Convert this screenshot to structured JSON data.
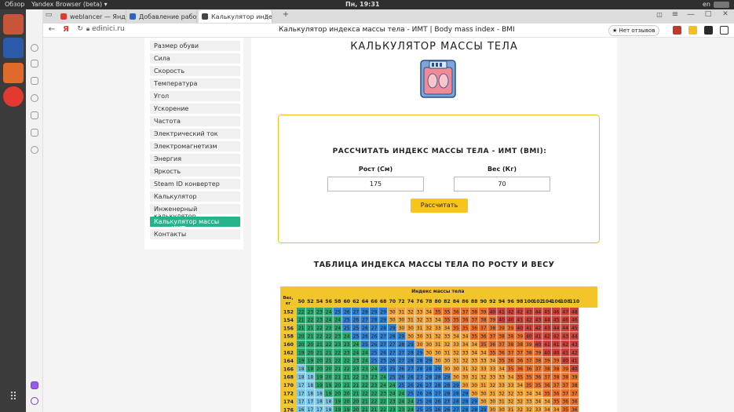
{
  "os": {
    "activities": "Обзор",
    "browser_name": "Yandex Browser (beta)",
    "clock": "Пн, 19:31",
    "lang": "en"
  },
  "tabs": [
    {
      "label": "weblancer — Яндекс:наш",
      "favcolor": "#e03a2e"
    },
    {
      "label": "Добавление работы в по",
      "favcolor": "#2a64c8"
    },
    {
      "label": "Калькулятор индекса м",
      "favcolor": "#444444"
    }
  ],
  "nav": {
    "url": "edinici.ru",
    "page_title": "Калькулятор индекса массы тела - ИМТ | Body mass index - BMI",
    "reviews": "★ Нет отзывов"
  },
  "menu": [
    "Размер обуви",
    "Сила",
    "Скорость",
    "Температура",
    "Угол",
    "Ускорение",
    "Частота",
    "Электрический ток",
    "Электромагнетизм",
    "Энергия",
    "Яркость",
    "Steam ID конвертер",
    "Калькулятор",
    "Инженерный калькулятор",
    "Калькулятор массы тела ИМТ",
    "Контакты"
  ],
  "menu_active": 14,
  "main": {
    "heading": "КАЛЬКУЛЯТОР МАССЫ ТЕЛА",
    "calc_title": "РАССЧИТАТЬ ИНДЕКС МАССЫ ТЕЛА - ИМТ (BMI):",
    "height_label": "Рост (См)",
    "weight_label": "Вес (Кг)",
    "height_value": "175",
    "weight_value": "70",
    "button": "Рассчитать",
    "table_title": "ТАБЛИЦА ИНДЕКСА МАССЫ ТЕЛА ПО РОСТУ И ВЕСУ"
  },
  "bmi_table": {
    "group_header": "Индекс массы тела",
    "corner": "Вес, кг",
    "weights": [
      50,
      52,
      54,
      56,
      58,
      60,
      62,
      64,
      66,
      68,
      70,
      72,
      74,
      76,
      78,
      80,
      82,
      84,
      86,
      88,
      90,
      92,
      94,
      96,
      98,
      100,
      102,
      104,
      106,
      108,
      110
    ],
    "heights": [
      152,
      154,
      156,
      158,
      160,
      162,
      164,
      166,
      168,
      170,
      172,
      174,
      176
    ],
    "rows": [
      [
        22,
        23,
        23,
        24,
        25,
        26,
        27,
        28,
        29,
        29,
        30,
        31,
        32,
        33,
        34,
        35,
        35,
        36,
        37,
        38,
        39,
        40,
        41,
        42,
        42,
        43,
        44,
        45,
        46,
        47,
        48
      ],
      [
        21,
        22,
        23,
        24,
        24,
        25,
        26,
        27,
        28,
        29,
        30,
        30,
        31,
        32,
        33,
        34,
        35,
        35,
        36,
        37,
        38,
        39,
        40,
        40,
        41,
        42,
        43,
        44,
        45,
        46,
        46
      ],
      [
        21,
        21,
        22,
        23,
        24,
        25,
        25,
        26,
        27,
        28,
        29,
        30,
        30,
        31,
        32,
        33,
        34,
        35,
        35,
        36,
        37,
        38,
        39,
        39,
        40,
        41,
        42,
        43,
        44,
        44,
        45
      ],
      [
        20,
        21,
        22,
        22,
        23,
        24,
        25,
        26,
        26,
        27,
        28,
        29,
        30,
        30,
        31,
        32,
        33,
        34,
        34,
        35,
        36,
        37,
        38,
        38,
        39,
        40,
        41,
        42,
        42,
        43,
        44
      ],
      [
        20,
        20,
        21,
        22,
        23,
        23,
        24,
        25,
        26,
        27,
        27,
        28,
        29,
        30,
        30,
        31,
        32,
        33,
        34,
        34,
        35,
        36,
        37,
        38,
        38,
        39,
        40,
        41,
        41,
        42,
        43
      ],
      [
        19,
        20,
        21,
        21,
        22,
        23,
        24,
        24,
        25,
        26,
        27,
        27,
        28,
        29,
        30,
        30,
        31,
        32,
        33,
        34,
        34,
        35,
        36,
        37,
        37,
        38,
        39,
        40,
        40,
        41,
        42
      ],
      [
        19,
        19,
        20,
        21,
        22,
        22,
        23,
        24,
        25,
        25,
        26,
        27,
        28,
        28,
        29,
        30,
        30,
        31,
        32,
        33,
        33,
        34,
        35,
        36,
        36,
        37,
        38,
        39,
        39,
        40,
        41
      ],
      [
        18,
        19,
        20,
        20,
        21,
        22,
        23,
        23,
        24,
        25,
        25,
        26,
        27,
        28,
        28,
        29,
        30,
        30,
        31,
        32,
        33,
        33,
        34,
        35,
        36,
        36,
        37,
        38,
        38,
        39,
        40
      ],
      [
        18,
        18,
        19,
        20,
        21,
        21,
        22,
        23,
        23,
        24,
        25,
        26,
        26,
        27,
        28,
        28,
        29,
        30,
        30,
        31,
        32,
        33,
        33,
        34,
        35,
        35,
        36,
        37,
        38,
        38,
        39
      ],
      [
        17,
        18,
        19,
        19,
        20,
        21,
        21,
        22,
        23,
        24,
        24,
        25,
        26,
        26,
        27,
        28,
        28,
        29,
        30,
        30,
        31,
        32,
        33,
        33,
        34,
        35,
        35,
        36,
        37,
        37,
        38
      ],
      [
        17,
        18,
        18,
        19,
        20,
        20,
        21,
        22,
        22,
        23,
        24,
        24,
        25,
        26,
        26,
        27,
        28,
        28,
        29,
        30,
        30,
        31,
        32,
        32,
        33,
        34,
        34,
        35,
        36,
        37,
        37
      ],
      [
        17,
        17,
        18,
        18,
        19,
        20,
        20,
        21,
        22,
        22,
        23,
        24,
        24,
        25,
        26,
        26,
        27,
        28,
        28,
        29,
        30,
        30,
        31,
        32,
        32,
        33,
        34,
        34,
        35,
        36,
        36
      ],
      [
        16,
        17,
        17,
        18,
        19,
        19,
        20,
        21,
        21,
        22,
        23,
        23,
        24,
        25,
        25,
        26,
        26,
        27,
        28,
        28,
        29,
        30,
        30,
        31,
        32,
        32,
        33,
        34,
        34,
        35,
        36
      ]
    ]
  },
  "colors": {
    "accent": "#26b38a",
    "button": "#f7c51a",
    "frame": "#f0c020",
    "under": "#7cc7e8",
    "normal": "#2aa66c",
    "normal_alt": "#2e7fd0",
    "over": "#f2a43a",
    "obese": "#e8712c",
    "obese2": "#c9433a",
    "header": "#f2c62a"
  }
}
